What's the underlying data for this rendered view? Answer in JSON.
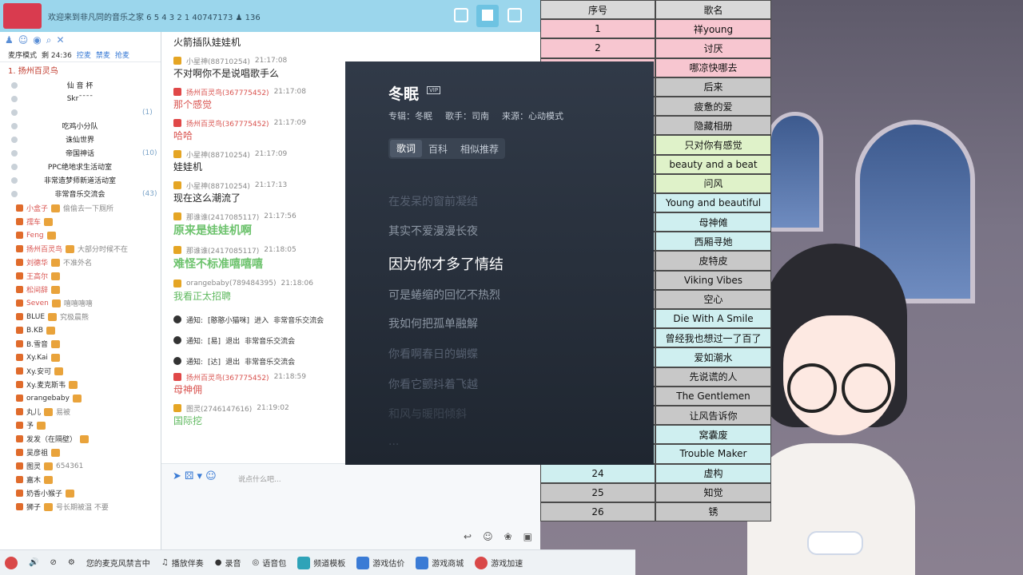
{
  "topbar": {
    "title": "欢迎来到非凡同的音乐之家  6 5 4 3 2 1  40747173  ♟ 136"
  },
  "sidebar": {
    "mode_label": "麦序模式",
    "timer": "剩 24:36",
    "links": [
      "控麦",
      "禁麦",
      "抢麦"
    ],
    "queue_item": "1.  扬州百灵鸟",
    "channels": [
      {
        "name": "仙 音 杯",
        "count": ""
      },
      {
        "name": "Skr¯¯¯¯",
        "count": ""
      },
      {
        "name": "",
        "count": "(1)"
      },
      {
        "name": "吃鸡小分队",
        "count": ""
      },
      {
        "name": "诛仙世界",
        "count": ""
      },
      {
        "name": "帝国神话",
        "count": "(10)"
      },
      {
        "name": "PPC绝地求生活动室",
        "count": ""
      },
      {
        "name": "非常造梦师新道活动室",
        "count": ""
      },
      {
        "name": "非常音乐交流会",
        "count": "(43)"
      }
    ],
    "members": [
      {
        "name": "小盒子",
        "vip": true,
        "msg": "偷偷去一下厕所"
      },
      {
        "name": "孺车",
        "vip": true,
        "msg": ""
      },
      {
        "name": "Feng",
        "vip": true,
        "msg": ""
      },
      {
        "name": "扬州百灵鸟",
        "vip": true,
        "msg": "大部分时候不在"
      },
      {
        "name": "刘德华",
        "vip": true,
        "msg": "不准外名"
      },
      {
        "name": "王高尔",
        "vip": true,
        "msg": ""
      },
      {
        "name": "松间辞",
        "vip": true,
        "msg": ""
      },
      {
        "name": "Seven",
        "vip": true,
        "msg": "嘻嘻嘻嘻"
      },
      {
        "name": "BLUE",
        "vip": false,
        "msg": "究极晨熊"
      },
      {
        "name": "B.KB",
        "vip": false,
        "msg": ""
      },
      {
        "name": "B.雪音",
        "vip": false,
        "msg": ""
      },
      {
        "name": "Xy.Kai",
        "vip": false,
        "msg": ""
      },
      {
        "name": "Xy.安可",
        "vip": false,
        "msg": ""
      },
      {
        "name": "Xy.麦克斯韦",
        "vip": false,
        "msg": ""
      },
      {
        "name": "orangebaby",
        "vip": false,
        "msg": ""
      },
      {
        "name": "丸儿",
        "vip": false,
        "msg": "易被"
      },
      {
        "name": "予",
        "vip": false,
        "msg": ""
      },
      {
        "name": "发发（在隔壁）",
        "vip": false,
        "msg": ""
      },
      {
        "name": "吴彦祖",
        "vip": false,
        "msg": ""
      },
      {
        "name": "图灵",
        "vip": false,
        "msg": "654361"
      },
      {
        "name": "嘉木",
        "vip": false,
        "msg": ""
      },
      {
        "name": "奶香小猴子",
        "vip": false,
        "msg": ""
      },
      {
        "name": "狮子",
        "vip": false,
        "msg": "号长期被温 不要"
      }
    ]
  },
  "chat": {
    "messages": [
      {
        "type": "plain",
        "body": "火箭插队娃娃机"
      },
      {
        "type": "msg",
        "user": "小星神(88710254)",
        "time": "21:17:08",
        "body": "不对啊你不是说唱歌手么",
        "style": ""
      },
      {
        "type": "msg",
        "user": "扬州百灵鸟(367775452)",
        "time": "21:17:08",
        "body": "那个感觉",
        "style": "red"
      },
      {
        "type": "msg",
        "user": "扬州百灵鸟(367775452)",
        "time": "21:17:09",
        "body": "哈哈",
        "style": "red"
      },
      {
        "type": "msg",
        "user": "小星神(88710254)",
        "time": "21:17:09",
        "body": "娃娃机",
        "style": ""
      },
      {
        "type": "msg",
        "user": "小星神(88710254)",
        "time": "21:17:13",
        "body": "现在这么潮流了",
        "style": ""
      },
      {
        "type": "msg",
        "user": "那谁谁(2417085117)",
        "time": "21:17:56",
        "body": "原来是娃娃机啊",
        "style": "green"
      },
      {
        "type": "msg",
        "user": "那谁谁(2417085117)",
        "time": "21:18:05",
        "body": "难怪不标准嘻嘻嘻",
        "style": "green"
      },
      {
        "type": "msg",
        "user": "orangebaby(789484395)",
        "time": "21:18:06",
        "body": "我看正太招聘",
        "style": "green2"
      }
    ],
    "notices": [
      {
        "label": "通知:",
        "who": "[憨憨小猫咪]",
        "act": "进入",
        "room": "非常音乐交流会"
      },
      {
        "label": "通知:",
        "who": "[易]",
        "act": "退出",
        "room": "非常音乐交流会"
      },
      {
        "label": "通知:",
        "who": "[达]",
        "act": "退出",
        "room": "非常音乐交流会"
      }
    ],
    "tail": [
      {
        "user": "扬州百灵鸟(367775452)",
        "time": "21:18:59",
        "body": "母神佣",
        "style": "red"
      },
      {
        "user": "图灵(2746147616)",
        "time": "21:19:02",
        "body": "国际挖",
        "style": "green2"
      }
    ],
    "input_placeholder": "说点什么吧..."
  },
  "bottombar": {
    "items": [
      "您的麦克风禁言中",
      "播放伴奏",
      "录音",
      "语音包",
      "频道模板",
      "游戏估价",
      "游戏商城",
      "游戏加速"
    ]
  },
  "songlist": {
    "headers": [
      "序号",
      "歌名"
    ],
    "rows": [
      {
        "n": "1",
        "title": "祥young",
        "color": "pink"
      },
      {
        "n": "2",
        "title": "讨厌",
        "color": "pink"
      },
      {
        "n": "",
        "title": "哪凉快哪去",
        "color": "pink"
      },
      {
        "n": "",
        "title": "后来",
        "color": "gray"
      },
      {
        "n": "",
        "title": "疲惫的爱",
        "color": "gray"
      },
      {
        "n": "",
        "title": "隐藏相册",
        "color": "gray"
      },
      {
        "n": "",
        "title": "只对你有感觉",
        "color": "green"
      },
      {
        "n": "",
        "title": "beauty and a beat",
        "color": "green"
      },
      {
        "n": "",
        "title": "问风",
        "color": "green"
      },
      {
        "n": "",
        "title": "Young and beautiful",
        "color": "cyan"
      },
      {
        "n": "",
        "title": "母神傩",
        "color": "cyan"
      },
      {
        "n": "",
        "title": "西厢寻她",
        "color": "cyan"
      },
      {
        "n": "",
        "title": "皮特皮",
        "color": "gray"
      },
      {
        "n": "",
        "title": "Viking Vibes",
        "color": "gray"
      },
      {
        "n": "",
        "title": "空心",
        "color": "gray"
      },
      {
        "n": "",
        "title": "Die With A Smile",
        "color": "cyan"
      },
      {
        "n": "",
        "title": "曾经我也想过一了百了",
        "color": "cyan"
      },
      {
        "n": "",
        "title": "爱如潮水",
        "color": "cyan"
      },
      {
        "n": "",
        "title": "先说谎的人",
        "color": "gray"
      },
      {
        "n": "",
        "title": "The Gentlemen",
        "color": "gray"
      },
      {
        "n": "",
        "title": "让风告诉你",
        "color": "gray"
      },
      {
        "n": "",
        "title": "窝囊废",
        "color": "cyan"
      },
      {
        "n": "",
        "title": "Trouble Maker",
        "color": "cyan"
      },
      {
        "n": "24",
        "title": "虚构",
        "color": "cyan"
      },
      {
        "n": "25",
        "title": "知觉",
        "color": "gray"
      },
      {
        "n": "26",
        "title": "锈",
        "color": "gray"
      }
    ]
  },
  "lyrics": {
    "title": "冬眠",
    "vip": "VIP",
    "album": "专辑：冬眠",
    "singer": "歌手：司南",
    "source": "来源：心动模式",
    "tabs": [
      "歌词",
      "百科",
      "相似推荐"
    ],
    "lines": [
      {
        "text": "在发呆的窗前凝结",
        "state": "dim"
      },
      {
        "text": "其实不爱漫漫长夜",
        "state": ""
      },
      {
        "text": "因为你才多了情结",
        "state": "cur"
      },
      {
        "text": "可是蜷缩的回忆不热烈",
        "state": ""
      },
      {
        "text": "我如何把孤单融解",
        "state": ""
      },
      {
        "text": "你看啊春日的蝴蝶",
        "state": "dim"
      },
      {
        "text": "你看它颤抖着飞越",
        "state": "dim"
      },
      {
        "text": "和风与暖阳倾斜",
        "state": "dimmer"
      },
      {
        "text": "...",
        "state": "dimmer"
      }
    ]
  },
  "colors": {
    "topbar": "#9bd6ec",
    "lyrics_bg": "#283140",
    "pink": "#f7c6d0",
    "gray": "#c8c8c8",
    "green": "#dff2c9",
    "cyan": "#cfeff0"
  }
}
